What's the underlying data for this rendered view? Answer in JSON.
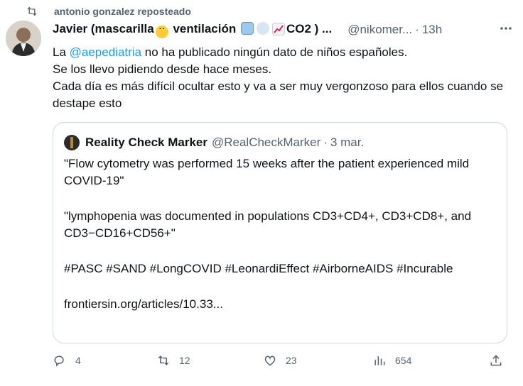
{
  "repost": {
    "icon": "repost-icon",
    "label": "antonio gonzalez reposteado"
  },
  "tweet": {
    "author_name": "Javier (mascarilla",
    "author_name_mid": " ventilación ",
    "author_name_end": "CO2 ) ...",
    "emojis": [
      "face-with-mask-icon",
      "window-icon",
      "wind-icon",
      "chart-increasing-icon"
    ],
    "handle": "@nikomer...",
    "separator": "·",
    "time": "13h",
    "more_icon": "more-icon",
    "text": {
      "line1_prefix": "La ",
      "line1_mention": "@aepediatria",
      "line1_suffix": " no ha publicado ningún dato de niños españoles.",
      "line2": "Se los llevo pidiendo desde hace meses.",
      "line3": "Cada día es más difícil ocultar esto y va a ser muy vergonzoso para ellos cuando se destape esto"
    }
  },
  "quote": {
    "author_name": "Reality Check Marker",
    "handle": "@RealCheckMarker",
    "separator": "·",
    "date": "3 mar.",
    "paragraphs": [
      "\"Flow cytometry was performed 15 weeks after the patient experienced mild COVID-19\"",
      "\"lymphopenia was documented in populations CD3+CD4+, CD3+CD8+, and CD3−CD16+CD56+\"",
      "#PASC #SAND #LongCOVID #LeonardiEffect #AirborneAIDS #Incurable",
      "frontiersin.org/articles/10.33..."
    ]
  },
  "actions": {
    "reply": {
      "icon": "reply-icon",
      "count": "4"
    },
    "repost": {
      "icon": "repost-icon",
      "count": "12"
    },
    "like": {
      "icon": "heart-icon",
      "count": "23"
    },
    "views": {
      "icon": "analytics-icon",
      "count": "654"
    },
    "share": {
      "icon": "share-icon"
    }
  },
  "colors": {
    "accent": "#1d9bf0",
    "muted": "#536471",
    "border": "#cfd9de"
  }
}
